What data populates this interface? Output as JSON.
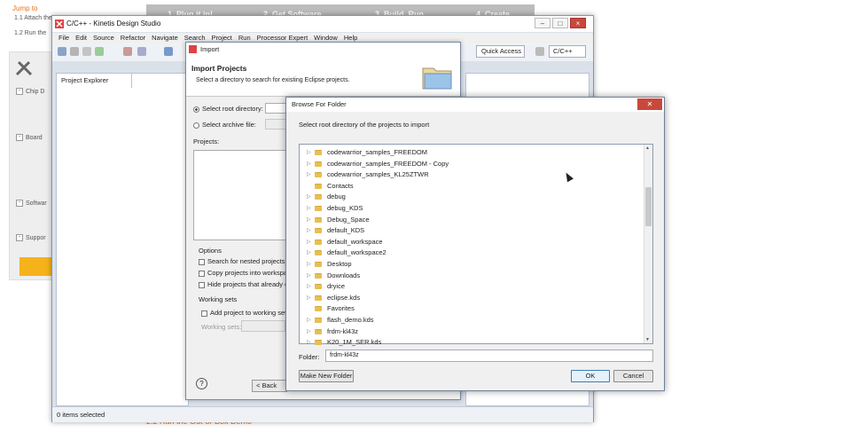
{
  "background_page": {
    "jump_to": "Jump to",
    "line1": "1.1 Attach the",
    "line2": "1.2 Run the",
    "steps": [
      "1. Plug it in!",
      "2. Get Software",
      "3. Build, Run",
      "4. Create"
    ],
    "sidebar_items": [
      "Chip D",
      "Board",
      "Softwar",
      "Suppor"
    ],
    "bottom_heading": "2.2 Run the Out-of-Box Demo"
  },
  "kds": {
    "title": "C/C++ - Kinetis Design Studio",
    "menu": [
      "File",
      "Edit",
      "Source",
      "Refactor",
      "Navigate",
      "Search",
      "Project",
      "Run",
      "Processor Expert",
      "Window",
      "Help"
    ],
    "quick_access": "Quick Access",
    "perspective": "C/C++",
    "explorer_tab": "Project Explorer",
    "status": "0 items selected"
  },
  "import_dialog": {
    "title": "Import",
    "heading": "Import Projects",
    "description": "Select a directory to search for existing Eclipse projects.",
    "root_dir_label": "Select root directory:",
    "archive_label": "Select archive file:",
    "projects_label": "Projects:",
    "options_label": "Options",
    "opt_nested": "Search for nested projects",
    "opt_copy": "Copy projects into workspac",
    "opt_hide": "Hide projects that already exi",
    "working_sets_label": "Working sets",
    "add_working": "Add project to working sets",
    "working_sets_field": "Working sets:",
    "back": "< Back"
  },
  "browse_dialog": {
    "title": "Browse For Folder",
    "description": "Select root directory of the projects to import",
    "folders": [
      {
        "name": "codewarrior_samples_FREEDOM",
        "arrow": true
      },
      {
        "name": "codewarrior_samples_FREEDOM - Copy",
        "arrow": true
      },
      {
        "name": "codewarrior_samples_KL25ZTWR",
        "arrow": true
      },
      {
        "name": "Contacts",
        "arrow": false
      },
      {
        "name": "debug",
        "arrow": true
      },
      {
        "name": "debug_KDS",
        "arrow": true
      },
      {
        "name": "Debug_Space",
        "arrow": true
      },
      {
        "name": "default_KDS",
        "arrow": true
      },
      {
        "name": "default_workspace",
        "arrow": true
      },
      {
        "name": "default_workspace2",
        "arrow": true
      },
      {
        "name": "Desktop",
        "arrow": true
      },
      {
        "name": "Downloads",
        "arrow": true
      },
      {
        "name": "dryice",
        "arrow": true
      },
      {
        "name": "eclipse.kds",
        "arrow": true
      },
      {
        "name": "Favorites",
        "arrow": false
      },
      {
        "name": "flash_demo.kds",
        "arrow": true
      },
      {
        "name": "frdm-kl43z",
        "arrow": true
      },
      {
        "name": "K20_1M_SER.kds",
        "arrow": true
      }
    ],
    "folder_label": "Folder:",
    "folder_value": "frdm-kl43z",
    "make_new_folder": "Make New Folder",
    "ok": "OK",
    "cancel": "Cancel"
  }
}
